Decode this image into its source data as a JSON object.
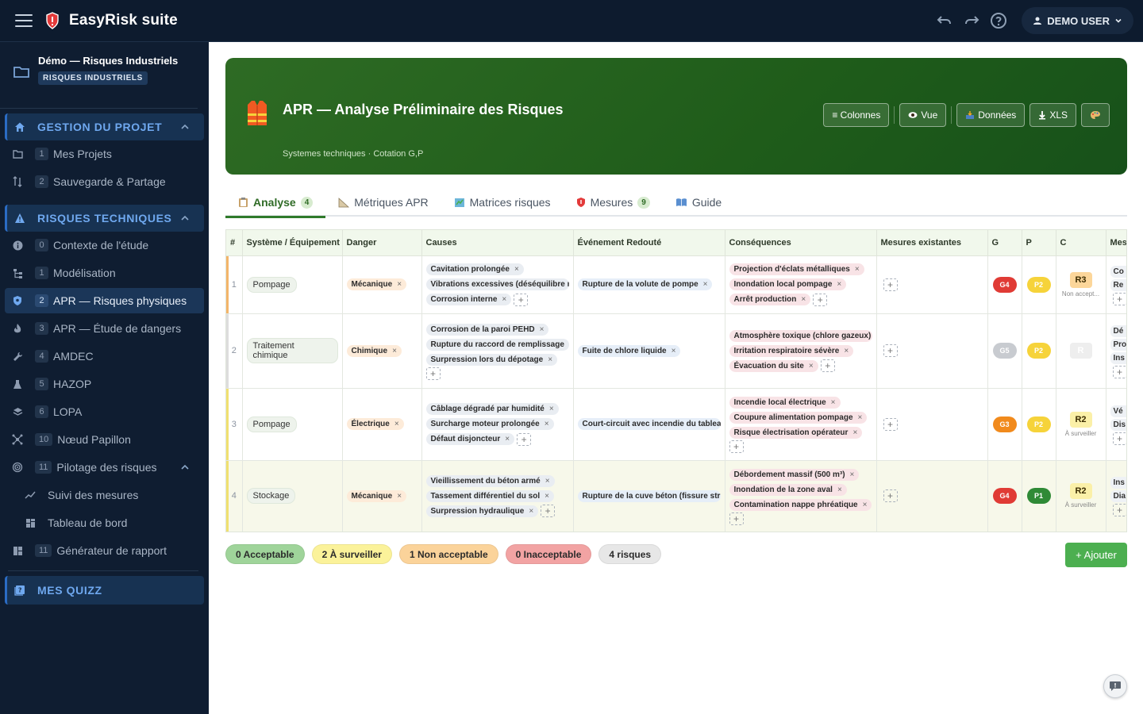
{
  "app": {
    "brand": "EasyRisk suite",
    "user": "DEMO USER"
  },
  "project": {
    "title": "Démo — Risques Industriels",
    "tag": "RISQUES INDUSTRIELS"
  },
  "sidebar": {
    "section1": "GESTION DU PROJET",
    "section1_items": [
      {
        "num": "1",
        "label": "Mes Projets",
        "icon": "folder-icon"
      },
      {
        "num": "2",
        "label": "Sauvegarde & Partage",
        "icon": "swap-icon"
      }
    ],
    "section2": "RISQUES TECHNIQUES O",
    "section2_items": [
      {
        "num": "0",
        "label": "Contexte de l'étude",
        "icon": "info-icon"
      },
      {
        "num": "1",
        "label": "Modélisation",
        "icon": "tree-icon"
      },
      {
        "num": "2",
        "label": "APR — Risques physiques",
        "icon": "shield-icon"
      },
      {
        "num": "3",
        "label": "APR — Étude de dangers",
        "icon": "flame-icon"
      },
      {
        "num": "4",
        "label": "AMDEC",
        "icon": "wrench-icon"
      },
      {
        "num": "5",
        "label": "HAZOP",
        "icon": "flask-icon"
      },
      {
        "num": "6",
        "label": "LOPA",
        "icon": "layers-icon"
      },
      {
        "num": "10",
        "label": "Nœud Papillon",
        "icon": "bowtie-icon"
      },
      {
        "num": "11",
        "label": "Pilotage des risques",
        "icon": "target-icon"
      }
    ],
    "sub_items": [
      "Suivi des mesures",
      "Tableau de bord"
    ],
    "report": {
      "num": "11",
      "label": "Générateur de rapport"
    },
    "quiz": "MES QUIZZ"
  },
  "hero": {
    "title": "APR — Analyse Préliminaire des Risques",
    "subtitle": "Systemes techniques · Cotation G,P",
    "buttons": {
      "colonnes": "≡ Colonnes",
      "vue": "Vue",
      "donnees": "Données",
      "xls": "XLS"
    }
  },
  "tabs": [
    {
      "label": "Analyse",
      "count": "4"
    },
    {
      "label": "Métriques APR"
    },
    {
      "label": "Matrices risques"
    },
    {
      "label": "Mesures",
      "count": "9"
    },
    {
      "label": "Guide"
    }
  ],
  "table": {
    "headers": [
      "#",
      "Système / Équipement",
      "Danger",
      "Causes",
      "Événement Redouté",
      "Conséquences",
      "Mesures existantes",
      "G",
      "P",
      "C",
      "Mes"
    ],
    "rows": [
      {
        "num": "1",
        "system": "Pompage",
        "danger": "Mécanique",
        "causes": [
          "Cavitation prolongée",
          "Vibrations excessives (déséquilibre rot",
          "Corrosion interne"
        ],
        "event": "Rupture de la volute de pompe",
        "consequences": [
          "Projection d'éclats métalliques",
          "Inondation local pompage",
          "Arrêt production"
        ],
        "g": "G4",
        "p": "P2",
        "r": "R3",
        "r_label": "Non accept...",
        "mes": [
          "Co",
          "Re"
        ]
      },
      {
        "num": "2",
        "system": "Traitement chimique",
        "danger": "Chimique",
        "causes": [
          "Corrosion de la paroi PEHD",
          "Rupture du raccord de remplissage",
          "Surpression lors du dépotage"
        ],
        "event": "Fuite de chlore liquide",
        "consequences": [
          "Atmosphère toxique (chlore gazeux)",
          "Irritation respiratoire sévère",
          "Évacuation du site"
        ],
        "g": "G5",
        "p": "P2",
        "r": "R",
        "r_label": "",
        "mes": [
          "Dé",
          "Pro",
          "Ins"
        ]
      },
      {
        "num": "3",
        "system": "Pompage",
        "danger": "Électrique",
        "causes": [
          "Câblage dégradé par humidité",
          "Surcharge moteur prolongée",
          "Défaut disjoncteur"
        ],
        "event": "Court-circuit avec incendie du tableau",
        "consequences": [
          "Incendie local électrique",
          "Coupure alimentation pompage",
          "Risque électrisation opérateur"
        ],
        "g": "G3",
        "p": "P2",
        "r": "R2",
        "r_label": "À surveiller",
        "mes": [
          "Vé",
          "Dis"
        ]
      },
      {
        "num": "4",
        "system": "Stockage",
        "danger": "Mécanique",
        "causes": [
          "Vieillissement du béton armé",
          "Tassement différentiel du sol",
          "Surpression hydraulique"
        ],
        "event": "Rupture de la cuve béton (fissure struc",
        "consequences": [
          "Débordement massif (500 m³)",
          "Inondation de la zone aval",
          "Contamination nappe phréatique"
        ],
        "g": "G4",
        "p": "P1",
        "r": "R2",
        "r_label": "À surveiller",
        "mes": [
          "Ins",
          "Dia"
        ]
      }
    ]
  },
  "stats": {
    "acceptable": "0 Acceptable",
    "surveiller": "2 À surveiller",
    "non_acceptable": "1 Non acceptable",
    "inacceptable": "0 Inacceptable",
    "total": "4 risques"
  },
  "add_button": "+ Ajouter"
}
